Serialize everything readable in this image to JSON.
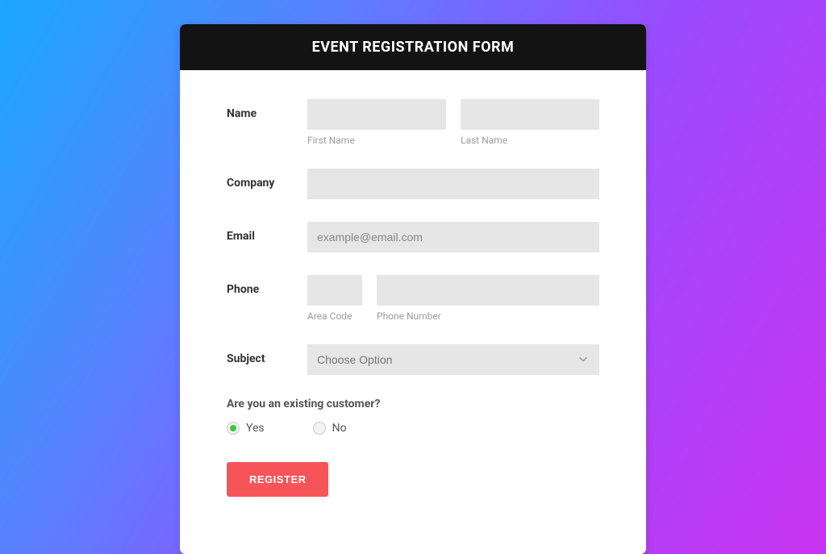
{
  "header": {
    "title": "EVENT REGISTRATION FORM"
  },
  "labels": {
    "name": "Name",
    "company": "Company",
    "email": "Email",
    "phone": "Phone",
    "subject": "Subject"
  },
  "sublabels": {
    "first_name": "First Name",
    "last_name": "Last Name",
    "area_code": "Area Code",
    "phone_number": "Phone Number"
  },
  "placeholders": {
    "email": "example@email.com",
    "subject": "Choose Option"
  },
  "existing_customer": {
    "question": "Are you an existing customer?",
    "yes": "Yes",
    "no": "No",
    "selected": "yes"
  },
  "buttons": {
    "register": "REGISTER"
  }
}
